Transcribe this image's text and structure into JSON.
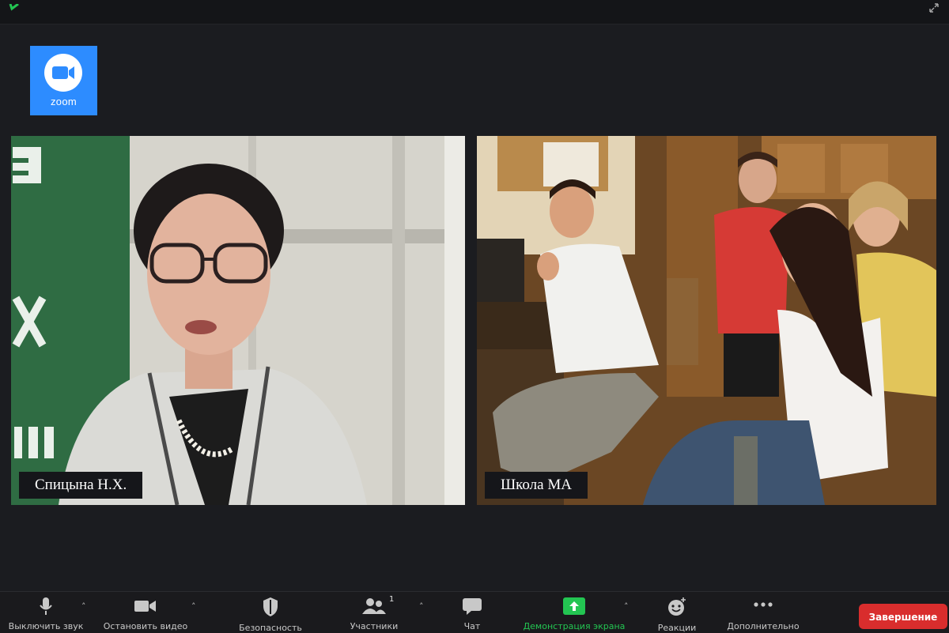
{
  "app": {
    "logo_text": "zoom",
    "brand_color": "#2d8cff"
  },
  "participants": [
    {
      "name": "Спицына Н.Х."
    },
    {
      "name": "Школа МА"
    }
  ],
  "toolbar": {
    "mute_label": "Выключить звук",
    "video_label": "Остановить видео",
    "security_label": "Безопасность",
    "participants_label": "Участники",
    "participants_count": "1",
    "chat_label": "Чат",
    "share_label": "Демонстрация экрана",
    "reactions_label": "Реакции",
    "more_label": "Дополнительно",
    "end_label": "Завершение",
    "share_color": "#23c552",
    "end_color": "#d92d2d"
  },
  "icons": [
    "shield-icon",
    "expand-icon",
    "zoom-camera-icon",
    "microphone-icon",
    "video-camera-icon",
    "security-shield-icon",
    "participants-icon",
    "chat-icon",
    "share-screen-icon",
    "reactions-icon",
    "more-icon"
  ]
}
